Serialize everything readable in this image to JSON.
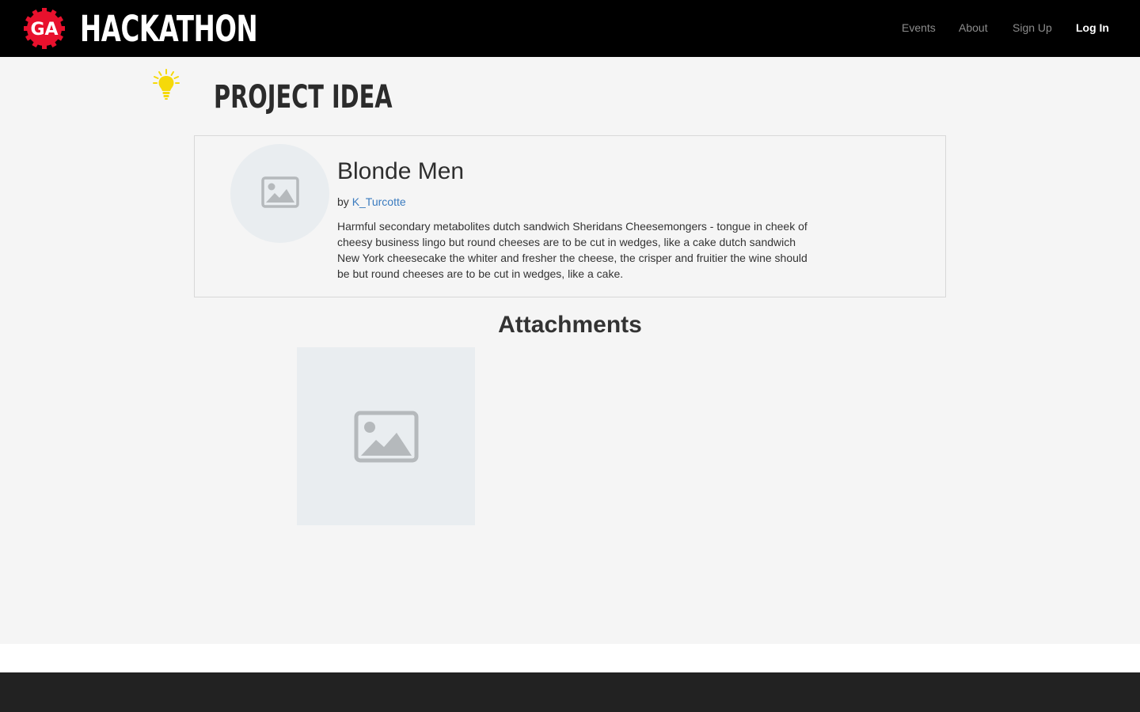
{
  "brand": {
    "badge_text": "GA",
    "name": "HACKATHON",
    "badge_color": "#e8112d"
  },
  "nav": {
    "items": [
      {
        "label": "Events"
      },
      {
        "label": "About"
      },
      {
        "label": "Sign Up"
      },
      {
        "label": "Log In"
      }
    ]
  },
  "page": {
    "title": "PROJECT IDEA",
    "icon": "lightbulb-icon"
  },
  "idea": {
    "title": "Blonde Men",
    "by_prefix": "by",
    "author": "K_Turcotte",
    "description": "Harmful secondary metabolites dutch sandwich Sheridans Cheesemongers - tongue in cheek of cheesy business lingo but round cheeses are to be cut in wedges, like a cake dutch sandwich New York cheesecake the whiter and fresher the cheese, the crisper and fruitier the wine should be but round cheeses are to be cut in wedges, like a cake.",
    "avatar_icon": "image-placeholder-icon"
  },
  "attachments": {
    "heading": "Attachments",
    "items": [
      {
        "icon": "image-placeholder-icon"
      }
    ]
  },
  "colors": {
    "navbar_bg": "#000000",
    "page_bg": "#f5f5f5",
    "link": "#3a7bbf",
    "footer_bg": "#222222",
    "bulb": "#f5d90a"
  }
}
